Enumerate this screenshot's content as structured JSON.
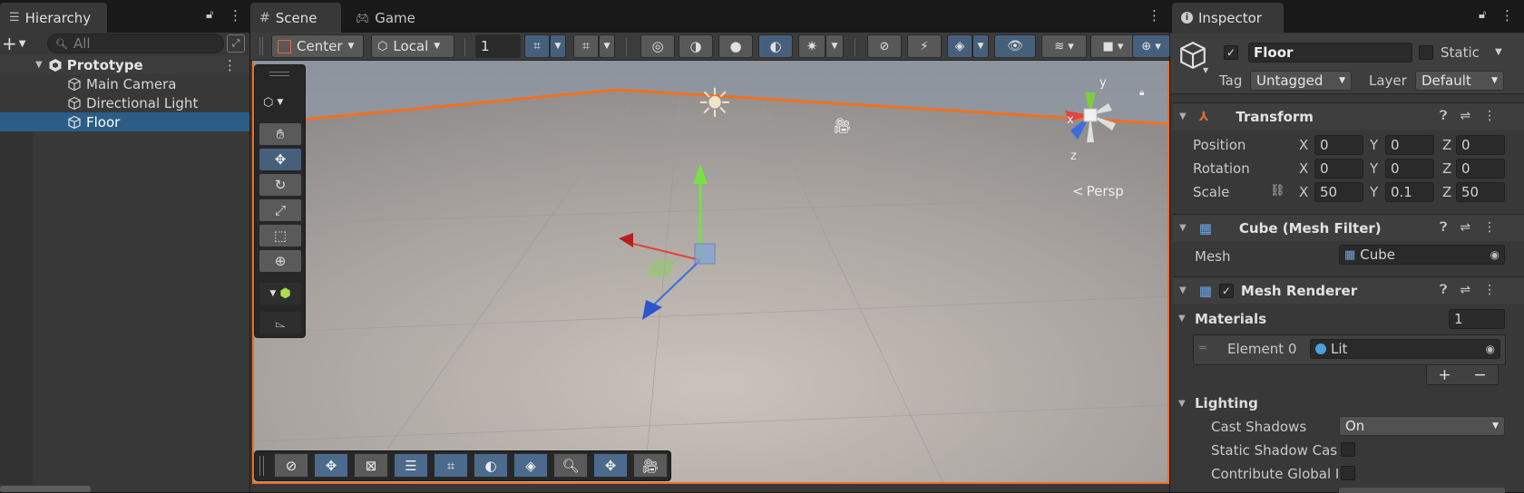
{
  "hierarchy": {
    "tab_label": "Hierarchy",
    "search_placeholder": "All",
    "scene_name": "Prototype",
    "items": [
      {
        "label": "Main Camera"
      },
      {
        "label": "Directional Light"
      },
      {
        "label": "Floor",
        "selected": true
      }
    ]
  },
  "scene_view": {
    "tabs": [
      {
        "label": "Scene",
        "active": true
      },
      {
        "label": "Game",
        "active": false
      }
    ],
    "pivot_label": "Center",
    "space_label": "Local",
    "grid_size_value": "1",
    "gizmo_persp_label": "Persp",
    "gizmo_axes": {
      "x": "x",
      "y": "y",
      "z": "z"
    }
  },
  "inspector": {
    "tab_label": "Inspector",
    "object_name": "Floor",
    "active_checked": true,
    "static_label": "Static",
    "tag_label": "Tag",
    "tag_value": "Untagged",
    "layer_label": "Layer",
    "layer_value": "Default",
    "transform": {
      "title": "Transform",
      "position": {
        "label": "Position",
        "x": "0",
        "y": "0",
        "z": "0"
      },
      "rotation": {
        "label": "Rotation",
        "x": "0",
        "y": "0",
        "z": "0"
      },
      "scale": {
        "label": "Scale",
        "x": "50",
        "y": "0.1",
        "z": "50"
      }
    },
    "mesh_filter": {
      "title": "Cube (Mesh Filter)",
      "mesh_label": "Mesh",
      "mesh_value": "Cube"
    },
    "mesh_renderer": {
      "title": "Mesh Renderer",
      "enabled": true,
      "materials_label": "Materials",
      "materials_count": "1",
      "element_label": "Element 0",
      "element_value": "Lit",
      "lighting_label": "Lighting",
      "cast_shadows_label": "Cast Shadows",
      "cast_shadows_value": "On",
      "static_shadow_label": "Static Shadow Cas",
      "contribute_gi_label": "Contribute Global I"
    }
  },
  "axis_letters": {
    "x": "X",
    "y": "Y",
    "z": "Z"
  },
  "colors": {
    "selection": "#2c5d87",
    "accent_toggle": "#46607c",
    "scene_border": "#f07020"
  }
}
